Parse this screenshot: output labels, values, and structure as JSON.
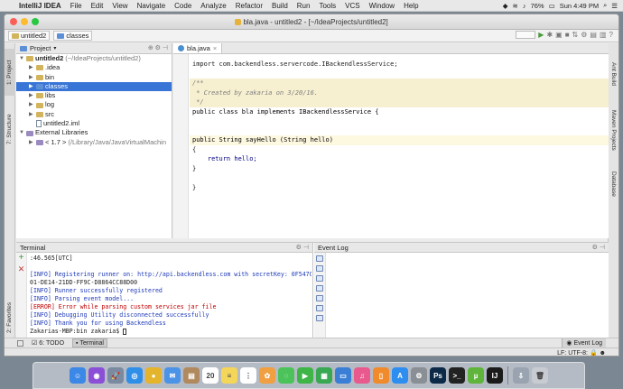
{
  "menubar": {
    "app": "IntelliJ IDEA",
    "items": [
      "File",
      "Edit",
      "View",
      "Navigate",
      "Code",
      "Analyze",
      "Refactor",
      "Build",
      "Run",
      "Tools",
      "VCS",
      "Window",
      "Help"
    ],
    "battery": "76%",
    "clock": "Sun 4:49 PM"
  },
  "window": {
    "title": "bla.java - untitled2 - [~/IdeaProjects/untitled2]"
  },
  "navbar": {
    "crumbs": [
      "untitled2",
      "classes"
    ]
  },
  "project_panel": {
    "header": "Project",
    "tree": [
      {
        "label": "untitled2",
        "detail": "(~/IdeaProjects/untitled2)",
        "depth": 0,
        "open": true,
        "icon": "folder",
        "bold": true
      },
      {
        "label": ".idea",
        "detail": "",
        "depth": 1,
        "open": false,
        "icon": "folder"
      },
      {
        "label": "bin",
        "detail": "",
        "depth": 1,
        "open": false,
        "icon": "folder"
      },
      {
        "label": "classes",
        "detail": "",
        "depth": 1,
        "open": false,
        "icon": "folder-blue",
        "selected": true
      },
      {
        "label": "libs",
        "detail": "",
        "depth": 1,
        "open": false,
        "icon": "folder"
      },
      {
        "label": "log",
        "detail": "",
        "depth": 1,
        "open": false,
        "icon": "folder"
      },
      {
        "label": "src",
        "detail": "",
        "depth": 1,
        "open": false,
        "icon": "folder"
      },
      {
        "label": "untitled2.iml",
        "detail": "",
        "depth": 1,
        "open": null,
        "icon": "file"
      },
      {
        "label": "External Libraries",
        "detail": "",
        "depth": 0,
        "open": true,
        "icon": "lib"
      },
      {
        "label": "< 1.7 >",
        "detail": "(/Library/Java/JavaVirtualMachin",
        "depth": 1,
        "open": false,
        "icon": "lib"
      }
    ]
  },
  "left_tabs": [
    "1: Project",
    "7: Structure"
  ],
  "right_tabs": [
    "Ant Build",
    "Maven Projects",
    "Database"
  ],
  "editor": {
    "tab": "bla.java",
    "lines": [
      {
        "text": "import com.backendless.servercode.IBackendlessService;",
        "style": "plain",
        "row": 0
      },
      {
        "text": "/**",
        "style": "cm",
        "row": 2
      },
      {
        "text": " * Created by zakaria on 3/20/16.",
        "style": "cm",
        "row": 3
      },
      {
        "text": " */",
        "style": "cm",
        "row": 4
      },
      {
        "text": "public class bla implements IBackendlessService {",
        "style": "decl",
        "row": 5
      },
      {
        "text": "public String sayHello (String hello)",
        "style": "method",
        "row": 8
      },
      {
        "text": "{",
        "style": "plain",
        "row": 9
      },
      {
        "text": "    return hello;",
        "style": "return",
        "row": 10
      },
      {
        "text": "}",
        "style": "plain",
        "row": 11
      },
      {
        "text": "}",
        "style": "plain",
        "row": 13
      }
    ]
  },
  "terminal": {
    "header": "Terminal",
    "lines": [
      {
        "text": ":46.565[UTC]",
        "kind": "plain"
      },
      {
        "text": "",
        "kind": "plain"
      },
      {
        "text": "[INFO] Registering runner on: http://api.backendless.com with secretKey: 0F547C",
        "kind": "info"
      },
      {
        "text": "01-DE14-21DD-FF9C-D8864CC88D00",
        "kind": "plain"
      },
      {
        "text": "[INFO] Runner successfully registered",
        "kind": "info"
      },
      {
        "text": "[INFO] Parsing event model...",
        "kind": "info"
      },
      {
        "text": "[ERROR] Error while parsing custom services jar file",
        "kind": "err"
      },
      {
        "text": "[INFO] Debugging Utility disconnected successfully",
        "kind": "info"
      },
      {
        "text": "[INFO] Thank you for using Backendless",
        "kind": "info"
      },
      {
        "text": "Zakarias-MBP:bin zakaria$ ",
        "kind": "plain"
      }
    ]
  },
  "event_log": {
    "header": "Event Log"
  },
  "bottom_bar": {
    "todo": "6: TODO",
    "terminal": "Terminal",
    "event_log": "Event Log",
    "favorites": "2: Favorites"
  },
  "status": {
    "line_sep": "LF:",
    "encoding": "UTF-8:"
  },
  "dock": {
    "apps": [
      {
        "name": "finder",
        "color": "#3b88e6",
        "glyph": "☺"
      },
      {
        "name": "siri",
        "color": "#8a4fd6",
        "glyph": "◉"
      },
      {
        "name": "launchpad",
        "color": "#7a8aa0",
        "glyph": "🚀"
      },
      {
        "name": "safari",
        "color": "#2f8fe8",
        "glyph": "◎"
      },
      {
        "name": "chrome",
        "color": "#e4b42c",
        "glyph": "●"
      },
      {
        "name": "mail",
        "color": "#4b93e6",
        "glyph": "✉"
      },
      {
        "name": "contacts",
        "color": "#b08a5e",
        "glyph": "▤"
      },
      {
        "name": "calendar",
        "color": "#ffffff",
        "glyph": "20"
      },
      {
        "name": "notes",
        "color": "#f4d65a",
        "glyph": "≡"
      },
      {
        "name": "reminders",
        "color": "#ffffff",
        "glyph": "⋮"
      },
      {
        "name": "photos",
        "color": "#f0a040",
        "glyph": "✿"
      },
      {
        "name": "messages",
        "color": "#4cc35a",
        "glyph": "◌"
      },
      {
        "name": "facetime",
        "color": "#3fb548",
        "glyph": "▶"
      },
      {
        "name": "numbers",
        "color": "#38a852",
        "glyph": "▦"
      },
      {
        "name": "keynote",
        "color": "#3a7fd5",
        "glyph": "▭"
      },
      {
        "name": "itunes",
        "color": "#e85a8e",
        "glyph": "♫"
      },
      {
        "name": "ibooks",
        "color": "#f08a2a",
        "glyph": "▯"
      },
      {
        "name": "appstore",
        "color": "#2d8ef0",
        "glyph": "A"
      },
      {
        "name": "preferences",
        "color": "#8a8f96",
        "glyph": "⚙"
      },
      {
        "name": "photoshop",
        "color": "#0c2a47",
        "glyph": "Ps"
      },
      {
        "name": "terminal",
        "color": "#222222",
        "glyph": ">_"
      },
      {
        "name": "utorrent",
        "color": "#5fb53b",
        "glyph": "µ"
      },
      {
        "name": "intellij",
        "color": "#1b1b1b",
        "glyph": "IJ"
      },
      {
        "name": "downloads",
        "color": "#9aa4b0",
        "glyph": "⇩"
      },
      {
        "name": "trash",
        "color": "#c8ccd2",
        "glyph": "🗑"
      }
    ]
  }
}
